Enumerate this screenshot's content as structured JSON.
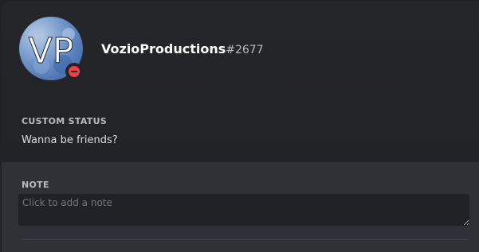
{
  "profile": {
    "username": "VozioProductions",
    "discriminator": "#2677",
    "avatar_initials": "VP",
    "status_color": "#ed4245",
    "status_icon": "dnd-icon"
  },
  "custom_status": {
    "title": "CUSTOM STATUS",
    "text": "Wanna be friends?"
  },
  "note": {
    "title": "NOTE",
    "placeholder": "Click to add a note",
    "value": ""
  }
}
